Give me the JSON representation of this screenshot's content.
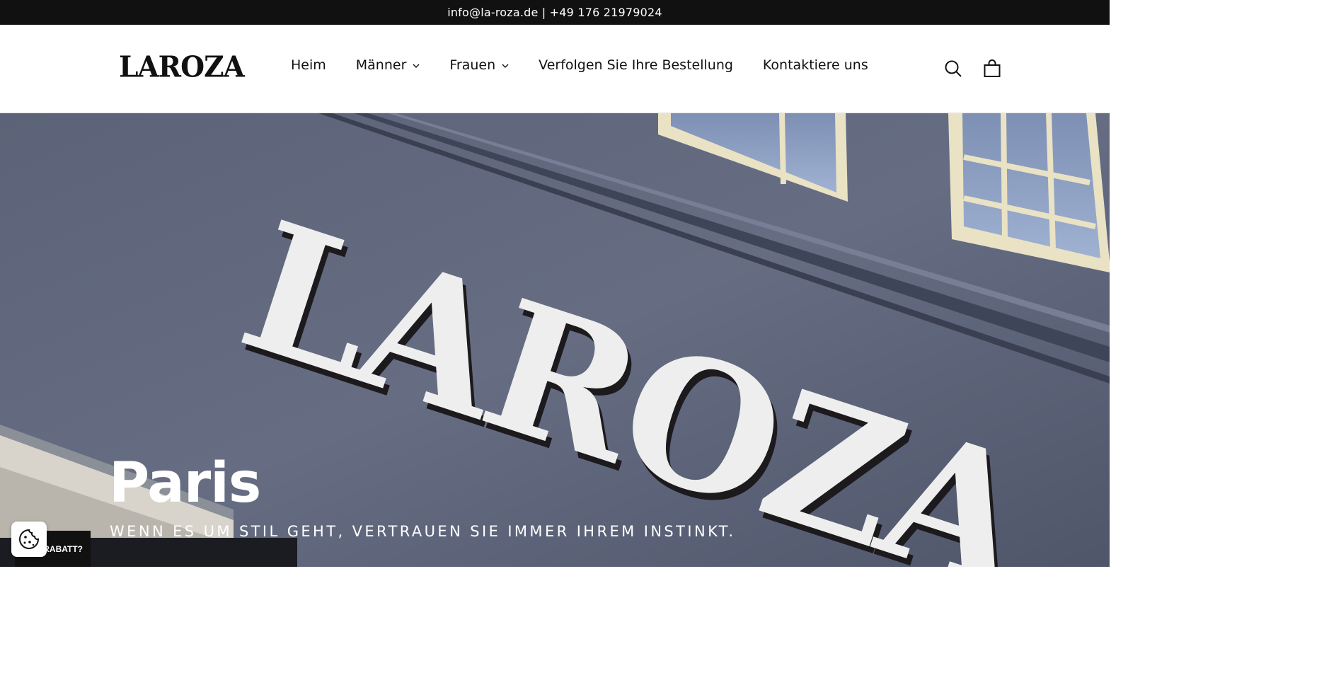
{
  "announcement": {
    "text": "info@la-roza.de | +49 176 21979024"
  },
  "header": {
    "logo_text": "LAROZA",
    "nav": [
      {
        "label": "Heim",
        "has_dropdown": false
      },
      {
        "label": "Männer",
        "has_dropdown": true
      },
      {
        "label": "Frauen",
        "has_dropdown": true
      },
      {
        "label": "Verfolgen Sie Ihre Bestellung",
        "has_dropdown": false
      },
      {
        "label": "Kontaktiere uns",
        "has_dropdown": false
      }
    ],
    "icons": {
      "search": "search-icon",
      "cart": "cart-icon"
    }
  },
  "hero": {
    "sign_text": "LAROZA",
    "title": "Paris",
    "subtitle": "WENN ES UM STIL GEHT, VERTRAUEN SIE IMMER IHREM INSTINKT."
  },
  "widgets": {
    "rabatt_label": "RABATT?",
    "cookie_icon": "cookie-icon"
  },
  "colors": {
    "announcement_bg": "#111111",
    "facade": "#5d6479",
    "text_light": "#ffffff"
  }
}
